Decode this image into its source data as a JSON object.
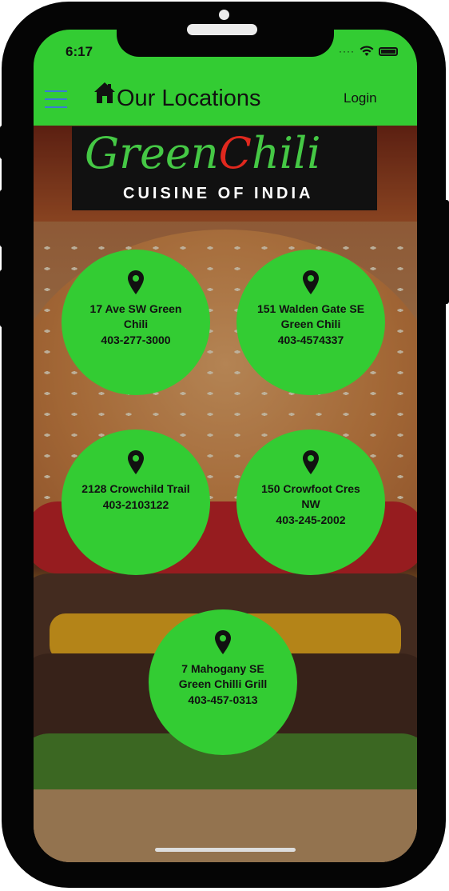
{
  "status_bar": {
    "time": "6:17"
  },
  "app_bar": {
    "title": "Our Locations",
    "login_label": "Login"
  },
  "logo": {
    "green_text": "Green",
    "chili_c": "C",
    "chili_rest": "hili",
    "tagline": "CUISINE OF INDIA"
  },
  "locations": [
    {
      "name": "17 Ave SW Green Chili",
      "phone": "403-277-3000"
    },
    {
      "name": "151 Walden Gate SE Green Chili",
      "phone": "403-4574337"
    },
    {
      "name": "2128 Crowchild Trail",
      "phone": "403-2103122"
    },
    {
      "name": "150 Crowfoot Cres NW",
      "phone": "403-245-2002"
    },
    {
      "name": "7 Mahogany SE Green Chilli Grill",
      "phone": "403-457-0313"
    }
  ],
  "icons": {
    "menu": "hamburger-icon",
    "home": "home-icon",
    "pin": "location-pin-icon"
  },
  "colors": {
    "accent": "#33cc33",
    "logo_green": "#45c845",
    "logo_red": "#e0281e"
  }
}
